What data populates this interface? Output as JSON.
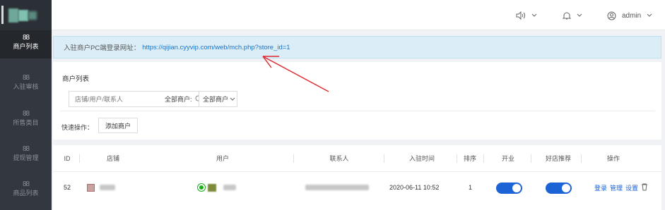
{
  "sidebar": {
    "items": [
      {
        "label": "商户列表",
        "icon": "grid-icon",
        "active": true
      },
      {
        "label": "入驻审核",
        "icon": "grid-icon",
        "active": false
      },
      {
        "label": "所售类目",
        "icon": "grid-icon",
        "active": false
      },
      {
        "label": "提现管理",
        "icon": "grid-icon",
        "active": false
      },
      {
        "label": "商品列表",
        "icon": "grid-icon",
        "active": false
      }
    ]
  },
  "header": {
    "sound_icon": "speaker-icon",
    "bell_icon": "bell-icon",
    "user_icon": "user-icon",
    "username": "admin"
  },
  "notice": {
    "label": "入驻商户PC端登录网址：",
    "url": "https://qijian.cyyvip.com/web/mch.php?store_id=1"
  },
  "list": {
    "title": "商户列表",
    "search_placeholder": "店铺/用户/联系人",
    "filter_label": "全部商户:",
    "filter_value": "全部商户",
    "quick_label": "快速操作：",
    "add_button": "添加商户"
  },
  "table": {
    "columns": [
      "ID",
      "店铺",
      "用户",
      "联系人",
      "入驻时间",
      "排序",
      "开业",
      "好店推荐",
      "操作"
    ],
    "rows": [
      {
        "id": "52",
        "join_time": "2020-06-11 10:52",
        "sort": "1",
        "open": true,
        "recommended": true,
        "actions": [
          "登录",
          "管理",
          "设置"
        ]
      }
    ]
  },
  "colors": {
    "sidebar_bg": "#333840",
    "accent": "#1c63d6",
    "notice_bg": "#dbeef7",
    "link": "#1a73c8",
    "annotation_arrow": "#e0262c"
  }
}
